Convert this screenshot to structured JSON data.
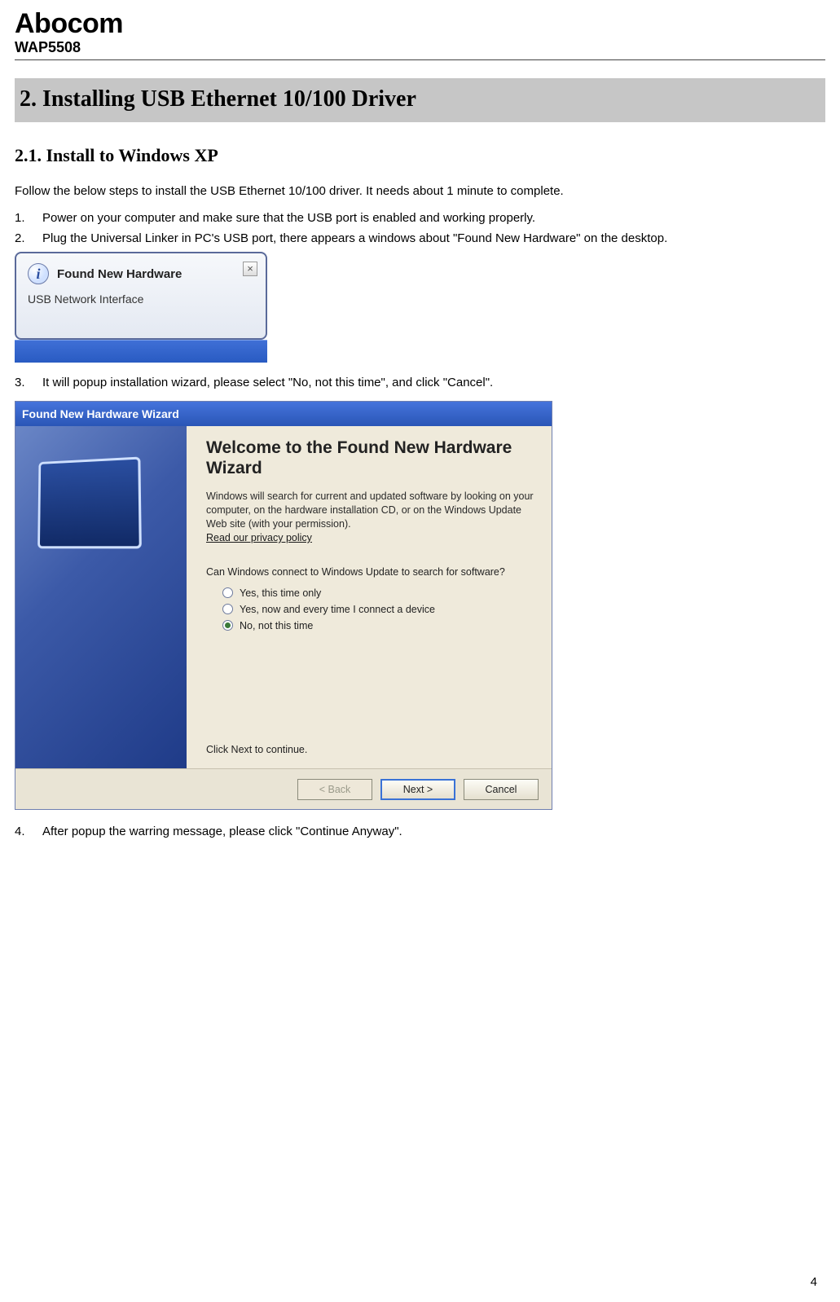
{
  "header": {
    "brand": "Abocom",
    "model": "WAP5508"
  },
  "section": {
    "heading": "2. Installing USB Ethernet 10/100 Driver",
    "subheading": "2.1.  Install to Windows XP",
    "intro": "Follow the below steps to install the USB Ethernet 10/100 driver. It needs about 1 minute to complete.",
    "steps": [
      "Power on your computer and make sure that the USB port is enabled and working properly.",
      "Plug the Universal Linker in PC's USB port, there appears a windows about \"Found New Hardware\" on the desktop.",
      "It will popup installation wizard, please select \"No, not this time\", and click \"Cancel\".",
      "After popup the warring message, please click \"Continue Anyway\"."
    ]
  },
  "balloon": {
    "title": "Found New Hardware",
    "subtitle": "USB Network Interface",
    "info_glyph": "i",
    "close_glyph": "×"
  },
  "wizard": {
    "titlebar": "Found New Hardware Wizard",
    "heading": "Welcome to the Found New Hardware Wizard",
    "paragraph": "Windows will search for current and updated software by looking on your computer, on the hardware installation CD, or on the Windows Update Web site (with your permission).",
    "privacy_link": "Read our privacy policy",
    "question": "Can Windows connect to Windows Update to search for software?",
    "options": [
      {
        "label": "Yes, this time only",
        "selected": false
      },
      {
        "label": "Yes, now and every time I connect a device",
        "selected": false
      },
      {
        "label": "No, not this time",
        "selected": true
      }
    ],
    "click_next": "Click Next to continue.",
    "buttons": {
      "back": "< Back",
      "next": "Next >",
      "cancel": "Cancel"
    }
  },
  "page_number": "4"
}
